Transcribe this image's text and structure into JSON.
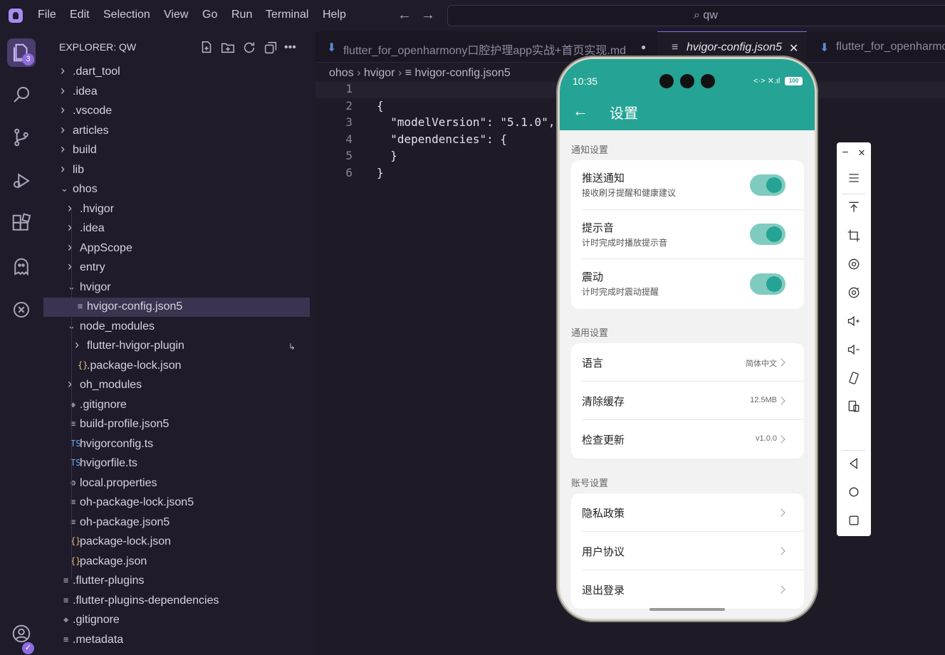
{
  "menu": [
    "File",
    "Edit",
    "Selection",
    "View",
    "Go",
    "Run",
    "Terminal",
    "Help"
  ],
  "search": {
    "value": "qw"
  },
  "activity": {
    "explorer_badge": "3"
  },
  "sidebar": {
    "header": "EXPLORER: QW",
    "tree": [
      {
        "label": ".dart_tool",
        "kind": "folder",
        "state": "closed"
      },
      {
        "label": ".idea",
        "kind": "folder",
        "state": "closed"
      },
      {
        "label": ".vscode",
        "kind": "folder",
        "state": "closed"
      },
      {
        "label": "articles",
        "kind": "folder",
        "state": "closed"
      },
      {
        "label": "build",
        "kind": "folder",
        "state": "closed"
      },
      {
        "label": "lib",
        "kind": "folder",
        "state": "closed"
      },
      {
        "label": "ohos",
        "kind": "folder",
        "state": "open"
      },
      {
        "label": ".hvigor",
        "kind": "folder",
        "state": "closed"
      },
      {
        "label": ".idea",
        "kind": "folder",
        "state": "closed"
      },
      {
        "label": "AppScope",
        "kind": "folder",
        "state": "closed"
      },
      {
        "label": "entry",
        "kind": "folder",
        "state": "closed"
      },
      {
        "label": "hvigor",
        "kind": "folder",
        "state": "open"
      },
      {
        "label": "hvigor-config.json5",
        "kind": "json5",
        "state": "file"
      },
      {
        "label": "node_modules",
        "kind": "folder",
        "state": "open"
      },
      {
        "label": "flutter-hvigor-plugin",
        "kind": "folder",
        "state": "closed"
      },
      {
        "label": ".package-lock.json",
        "kind": "json",
        "state": "file"
      },
      {
        "label": "oh_modules",
        "kind": "folder",
        "state": "closed"
      },
      {
        "label": ".gitignore",
        "kind": "git",
        "state": "file"
      },
      {
        "label": "build-profile.json5",
        "kind": "json5",
        "state": "file"
      },
      {
        "label": "hvigorconfig.ts",
        "kind": "ts",
        "state": "file"
      },
      {
        "label": "hvigorfile.ts",
        "kind": "ts",
        "state": "file"
      },
      {
        "label": "local.properties",
        "kind": "gear",
        "state": "file"
      },
      {
        "label": "oh-package-lock.json5",
        "kind": "json5",
        "state": "file"
      },
      {
        "label": "oh-package.json5",
        "kind": "json5",
        "state": "file"
      },
      {
        "label": "package-lock.json",
        "kind": "json",
        "state": "file"
      },
      {
        "label": "package.json",
        "kind": "json",
        "state": "file"
      },
      {
        "label": ".flutter-plugins",
        "kind": "json5",
        "state": "file"
      },
      {
        "label": ".flutter-plugins-dependencies",
        "kind": "json5",
        "state": "file"
      },
      {
        "label": ".gitignore",
        "kind": "git",
        "state": "file"
      },
      {
        "label": ".metadata",
        "kind": "json5",
        "state": "file"
      }
    ]
  },
  "tabs": [
    {
      "label": "flutter_for_openharmony口腔护理app实战+首页实现.md"
    },
    {
      "label": "hvigor-config.json5"
    },
    {
      "label": "flutter_for_openharmo"
    }
  ],
  "breadcrumb": [
    "ohos",
    "hvigor",
    "hvigor-config.json5"
  ],
  "code": [
    {
      "n": "1",
      "text": ""
    },
    {
      "n": "2",
      "text": "{"
    },
    {
      "n": "3",
      "text": "  \"modelVersion\": \"5.1.0\","
    },
    {
      "n": "4",
      "text": "  \"dependencies\": {"
    },
    {
      "n": "5",
      "text": "  }"
    },
    {
      "n": "6",
      "text": "}"
    }
  ],
  "phone": {
    "time": "10:35",
    "status_icons": "<·> ✕.ıl",
    "battery": "100",
    "back": "←",
    "title": "设置",
    "accent": "#25a394",
    "sections": [
      {
        "title": "通知设置",
        "items": [
          {
            "title": "推送通知",
            "sub": "接收刷牙提醒和健康建议",
            "toggle": true
          },
          {
            "title": "提示音",
            "sub": "计时完成时播放提示音",
            "toggle": true
          },
          {
            "title": "震动",
            "sub": "计时完成时震动提醒",
            "toggle": true
          }
        ]
      },
      {
        "title": "通用设置",
        "items": [
          {
            "title": "语言",
            "value": "简体中文"
          },
          {
            "title": "清除缓存",
            "value": "12.5MB"
          },
          {
            "title": "检查更新",
            "value": "v1.0.0"
          }
        ]
      },
      {
        "title": "账号设置",
        "items": [
          {
            "title": "隐私政策"
          },
          {
            "title": "用户协议"
          },
          {
            "title": "退出登录"
          }
        ]
      }
    ]
  },
  "floatbar": {
    "minimize": "−",
    "close": "✕"
  }
}
